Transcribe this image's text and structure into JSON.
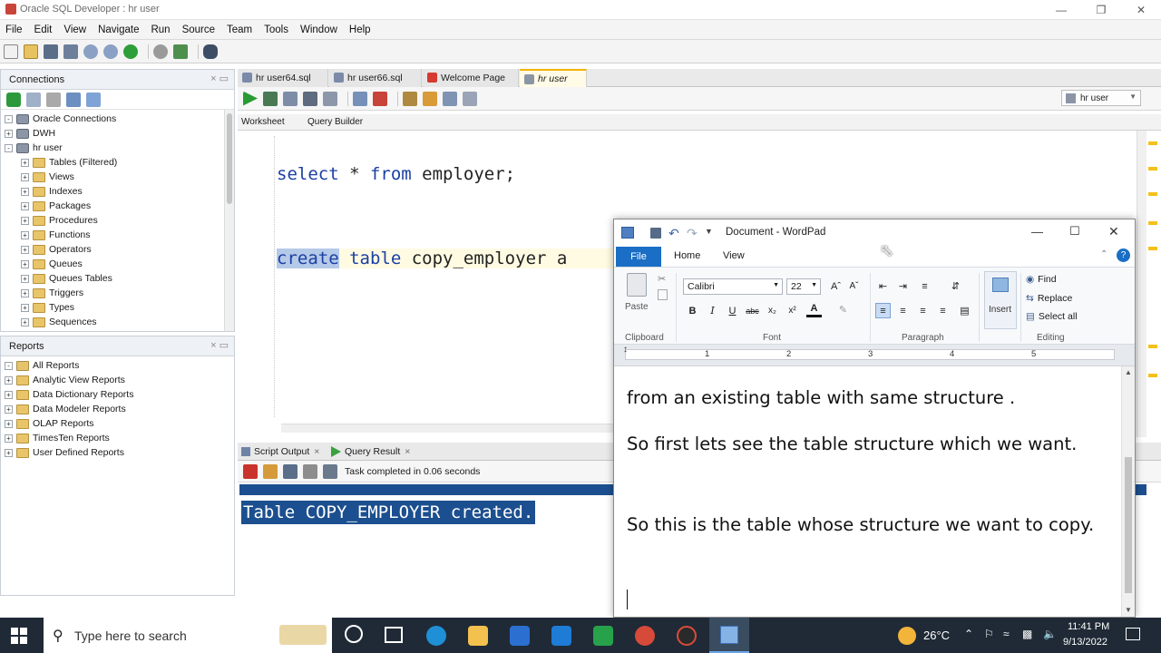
{
  "window": {
    "title": "Oracle SQL Developer : hr user"
  },
  "menu": [
    "File",
    "Edit",
    "View",
    "Navigate",
    "Run",
    "Source",
    "Team",
    "Tools",
    "Window",
    "Help"
  ],
  "connections": {
    "title": "Connections",
    "root": "Oracle Connections",
    "items": [
      "DWH",
      "hr user"
    ],
    "children": [
      "Tables (Filtered)",
      "Views",
      "Indexes",
      "Packages",
      "Procedures",
      "Functions",
      "Operators",
      "Queues",
      "Queues Tables",
      "Triggers",
      "Types",
      "Sequences"
    ]
  },
  "reports": {
    "title": "Reports",
    "root": "All Reports",
    "items": [
      "Analytic View Reports",
      "Data Dictionary Reports",
      "Data Modeler Reports",
      "OLAP Reports",
      "TimesTen Reports",
      "User Defined Reports"
    ]
  },
  "editor": {
    "tabs": [
      "hr user64.sql",
      "hr user66.sql",
      "Welcome Page",
      "hr user"
    ],
    "connection": "hr user",
    "subtabs": [
      "Worksheet",
      "Query Builder"
    ],
    "line1": {
      "kw1": "select",
      "rest1": " * ",
      "kw2": "from",
      "rest2": " employer;"
    },
    "line2": {
      "kw1": "create",
      "kw2": "table",
      "rest": " copy_employer a"
    }
  },
  "output": {
    "tabs": [
      "Script Output",
      "Query Result"
    ],
    "status": "Task completed in 0.06 seconds",
    "text": "Table COPY_EMPLOYER created."
  },
  "wordpad": {
    "title": "Document - WordPad",
    "menu": [
      "File",
      "Home",
      "View"
    ],
    "font": "Calibri",
    "size": "22",
    "groups": [
      "Clipboard",
      "Font",
      "Paragraph",
      "Editing"
    ],
    "paste": "Paste",
    "insert": "Insert",
    "editing": [
      "Find",
      "Replace",
      "Select all"
    ],
    "ruler": [
      "1",
      "2",
      "3",
      "4",
      "5"
    ],
    "paragraphs": [
      "from an existing table with same structure .",
      "So first lets see the table structure which we want.",
      "So this is the table whose structure we want to copy."
    ]
  },
  "taskbar": {
    "search_placeholder": "Type here to search",
    "weather": "26°C",
    "time": "11:41 PM",
    "date": "9/13/2022"
  },
  "colors": {
    "keyword": "#1b3fa4",
    "selection": "#b5c9e8",
    "output_selection": "#1c4f8f",
    "wordpad_accent": "#1a6ec5"
  }
}
